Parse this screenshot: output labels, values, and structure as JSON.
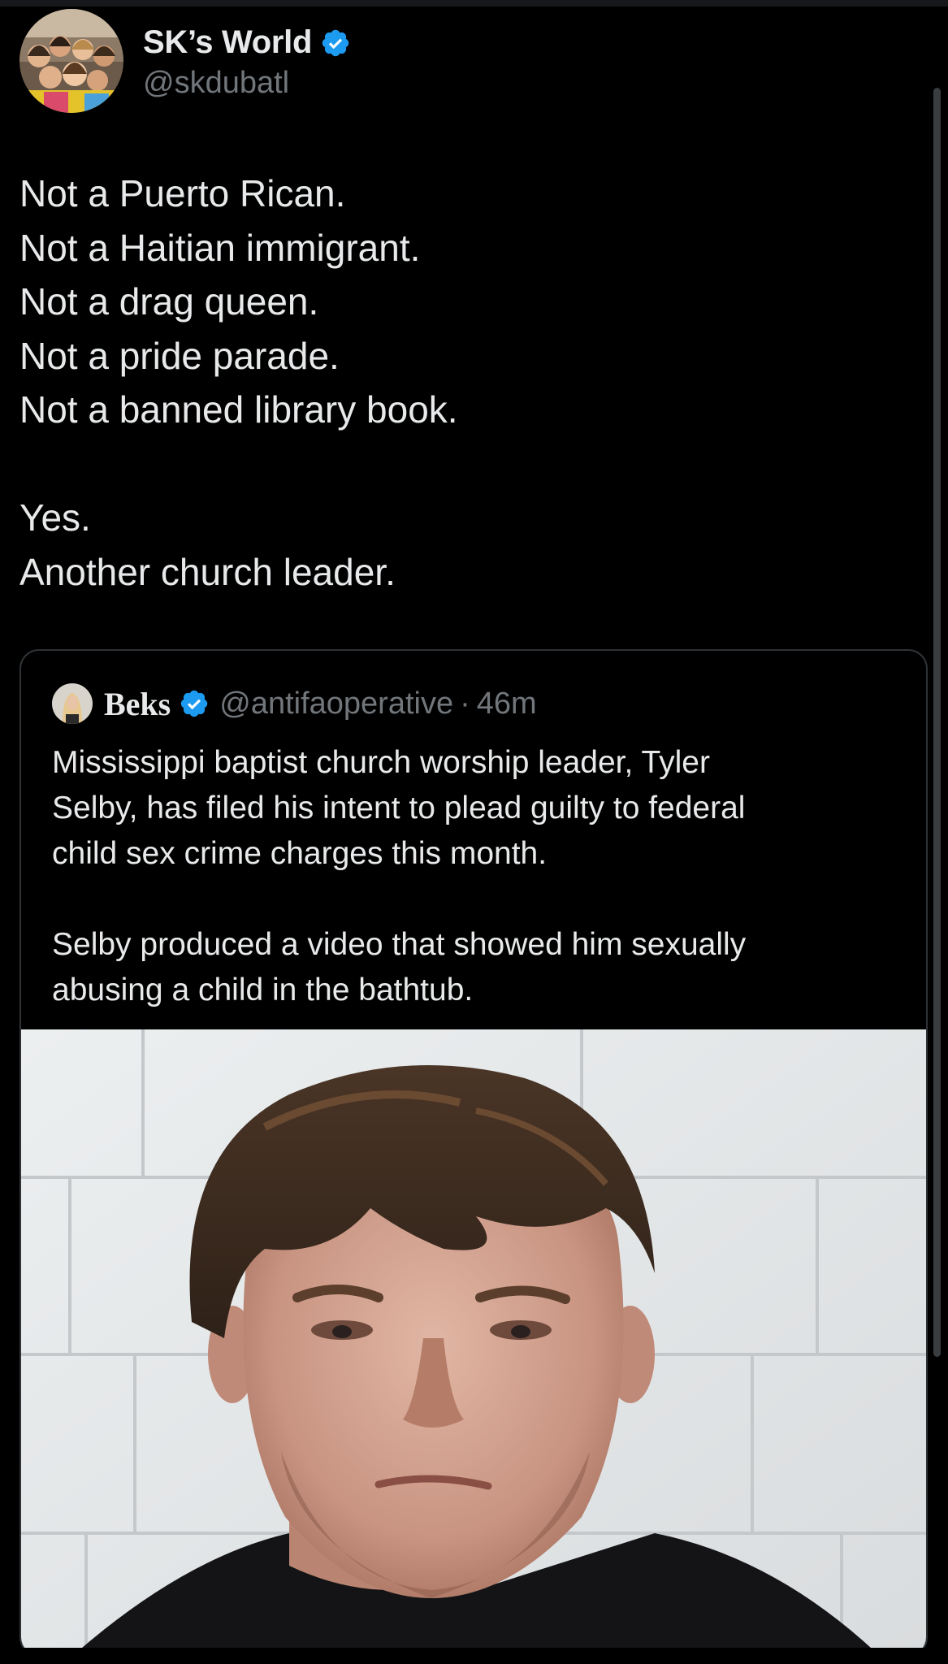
{
  "author": {
    "display_name": "SK’s World",
    "handle": "@skdubatl",
    "verified_icon": "verified-badge-icon",
    "avatar_icon": "group-selfie-avatar"
  },
  "tweet": {
    "lines": [
      "Not a Puerto Rican.",
      "Not a Haitian immigrant.",
      "Not a drag queen.",
      "Not a pride parade.",
      "Not a banned library book.",
      "",
      "Yes.",
      "Another church leader."
    ]
  },
  "quoted_tweet": {
    "display_name": "Beks",
    "handle": "@antifaoperative",
    "separator": "·",
    "time": "46m",
    "lines": [
      "Mississippi baptist church worship leader, Tyler",
      "Selby, has filed his intent to plead guilty to federal",
      "child sex crime charges this month.",
      "",
      "Selby produced a video that showed him sexually",
      "abusing a child in the bathtub."
    ],
    "media_icon": "mugshot-photo"
  },
  "colors": {
    "background": "#000000",
    "text_primary": "#e7e9ea",
    "text_secondary": "#71767b",
    "verified_blue": "#1d9bf0",
    "border": "#2f3336"
  }
}
